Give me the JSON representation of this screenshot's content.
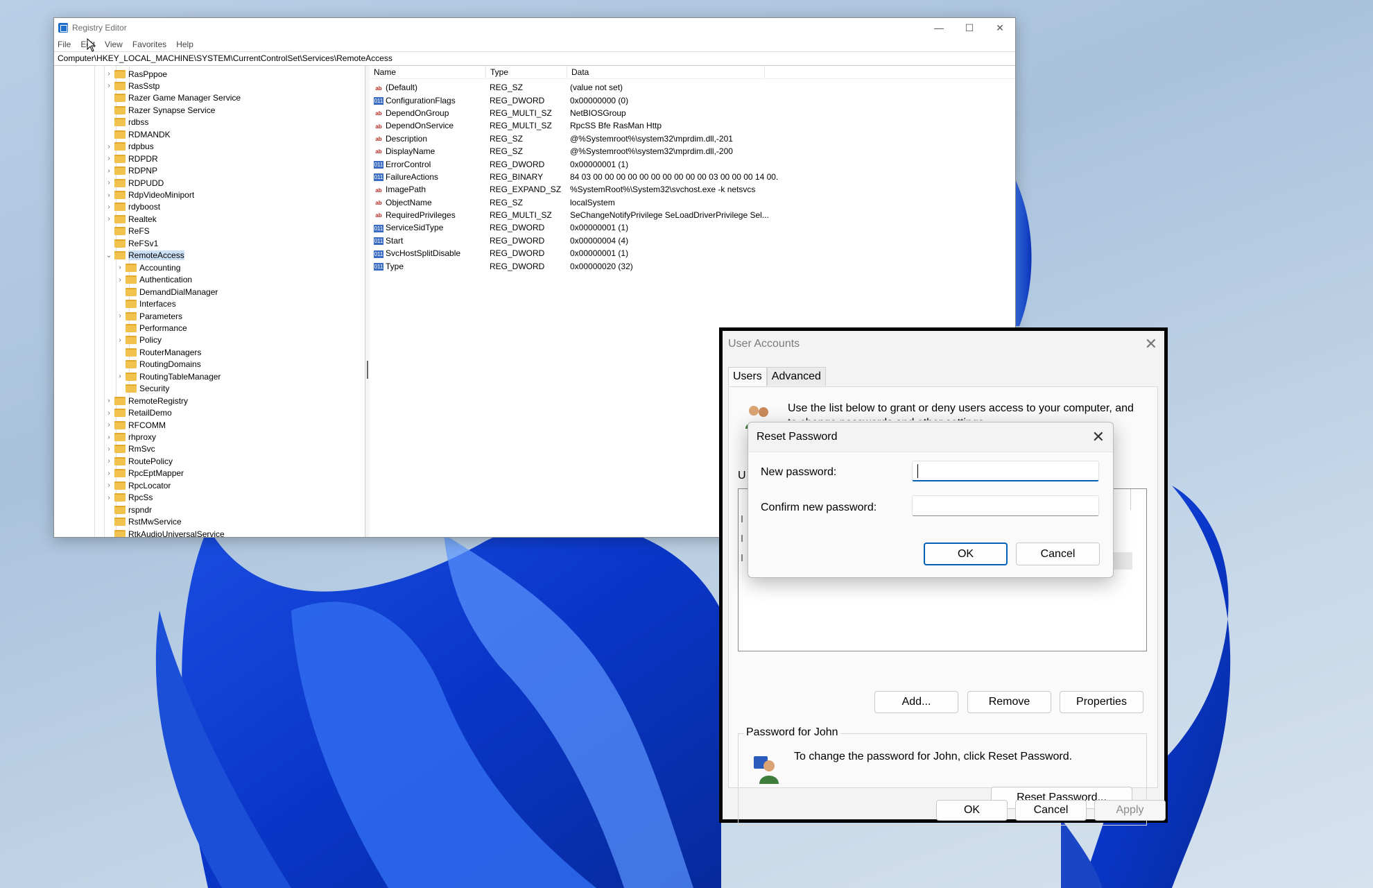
{
  "regedit": {
    "title": "Registry Editor",
    "menu": [
      "File",
      "Edit",
      "View",
      "Favorites",
      "Help"
    ],
    "address": "Computer\\HKEY_LOCAL_MACHINE\\SYSTEM\\CurrentControlSet\\Services\\RemoteAccess",
    "tree": [
      {
        "label": "RasPppoe",
        "level": 0,
        "expander": true
      },
      {
        "label": "RasSstp",
        "level": 0,
        "expander": true
      },
      {
        "label": "Razer Game Manager Service",
        "level": 0,
        "expander": false
      },
      {
        "label": "Razer Synapse Service",
        "level": 0,
        "expander": false
      },
      {
        "label": "rdbss",
        "level": 0,
        "expander": false
      },
      {
        "label": "RDMANDK",
        "level": 0,
        "expander": false
      },
      {
        "label": "rdpbus",
        "level": 0,
        "expander": true
      },
      {
        "label": "RDPDR",
        "level": 0,
        "expander": true
      },
      {
        "label": "RDPNP",
        "level": 0,
        "expander": true
      },
      {
        "label": "RDPUDD",
        "level": 0,
        "expander": true
      },
      {
        "label": "RdpVideoMiniport",
        "level": 0,
        "expander": true
      },
      {
        "label": "rdyboost",
        "level": 0,
        "expander": true
      },
      {
        "label": "Realtek",
        "level": 0,
        "expander": true
      },
      {
        "label": "ReFS",
        "level": 0,
        "expander": false
      },
      {
        "label": "ReFSv1",
        "level": 0,
        "expander": false
      },
      {
        "label": "RemoteAccess",
        "level": 0,
        "expander": true,
        "expanded": true,
        "selected": true
      },
      {
        "label": "Accounting",
        "level": 1,
        "expander": true
      },
      {
        "label": "Authentication",
        "level": 1,
        "expander": true
      },
      {
        "label": "DemandDialManager",
        "level": 1,
        "expander": false
      },
      {
        "label": "Interfaces",
        "level": 1,
        "expander": false
      },
      {
        "label": "Parameters",
        "level": 1,
        "expander": true
      },
      {
        "label": "Performance",
        "level": 1,
        "expander": false
      },
      {
        "label": "Policy",
        "level": 1,
        "expander": true
      },
      {
        "label": "RouterManagers",
        "level": 1,
        "expander": false
      },
      {
        "label": "RoutingDomains",
        "level": 1,
        "expander": false
      },
      {
        "label": "RoutingTableManager",
        "level": 1,
        "expander": true
      },
      {
        "label": "Security",
        "level": 1,
        "expander": false
      },
      {
        "label": "RemoteRegistry",
        "level": 0,
        "expander": true
      },
      {
        "label": "RetailDemo",
        "level": 0,
        "expander": true
      },
      {
        "label": "RFCOMM",
        "level": 0,
        "expander": true
      },
      {
        "label": "rhproxy",
        "level": 0,
        "expander": true
      },
      {
        "label": "RmSvc",
        "level": 0,
        "expander": true
      },
      {
        "label": "RoutePolicy",
        "level": 0,
        "expander": true
      },
      {
        "label": "RpcEptMapper",
        "level": 0,
        "expander": true
      },
      {
        "label": "RpcLocator",
        "level": 0,
        "expander": true
      },
      {
        "label": "RpcSs",
        "level": 0,
        "expander": true
      },
      {
        "label": "rspndr",
        "level": 0,
        "expander": false
      },
      {
        "label": "RstMwService",
        "level": 0,
        "expander": false
      },
      {
        "label": "RtkAudioUniversalService",
        "level": 0,
        "expander": false
      }
    ],
    "columns": [
      "Name",
      "Type",
      "Data"
    ],
    "values": [
      {
        "name": "(Default)",
        "type": "REG_SZ",
        "data": "(value not set)",
        "icon": "string-value-icon"
      },
      {
        "name": "ConfigurationFlags",
        "type": "REG_DWORD",
        "data": "0x00000000 (0)",
        "icon": "binary-value-icon"
      },
      {
        "name": "DependOnGroup",
        "type": "REG_MULTI_SZ",
        "data": "NetBIOSGroup",
        "icon": "string-value-icon"
      },
      {
        "name": "DependOnService",
        "type": "REG_MULTI_SZ",
        "data": "RpcSS Bfe RasMan Http",
        "icon": "string-value-icon"
      },
      {
        "name": "Description",
        "type": "REG_SZ",
        "data": "@%Systemroot%\\system32\\mprdim.dll,-201",
        "icon": "string-value-icon"
      },
      {
        "name": "DisplayName",
        "type": "REG_SZ",
        "data": "@%Systemroot%\\system32\\mprdim.dll,-200",
        "icon": "string-value-icon"
      },
      {
        "name": "ErrorControl",
        "type": "REG_DWORD",
        "data": "0x00000001 (1)",
        "icon": "binary-value-icon"
      },
      {
        "name": "FailureActions",
        "type": "REG_BINARY",
        "data": "84 03 00 00 00 00 00 00 00 00 00 00 03 00 00 00 14 00...",
        "icon": "binary-value-icon"
      },
      {
        "name": "ImagePath",
        "type": "REG_EXPAND_SZ",
        "data": "%SystemRoot%\\System32\\svchost.exe -k netsvcs",
        "icon": "string-value-icon"
      },
      {
        "name": "ObjectName",
        "type": "REG_SZ",
        "data": "localSystem",
        "icon": "string-value-icon"
      },
      {
        "name": "RequiredPrivileges",
        "type": "REG_MULTI_SZ",
        "data": "SeChangeNotifyPrivilege SeLoadDriverPrivilege Sel...",
        "icon": "string-value-icon"
      },
      {
        "name": "ServiceSidType",
        "type": "REG_DWORD",
        "data": "0x00000001 (1)",
        "icon": "binary-value-icon"
      },
      {
        "name": "Start",
        "type": "REG_DWORD",
        "data": "0x00000004 (4)",
        "icon": "binary-value-icon"
      },
      {
        "name": "SvcHostSplitDisable",
        "type": "REG_DWORD",
        "data": "0x00000001 (1)",
        "icon": "binary-value-icon"
      },
      {
        "name": "Type",
        "type": "REG_DWORD",
        "data": "0x00000020 (32)",
        "icon": "binary-value-icon"
      }
    ]
  },
  "user_accounts": {
    "title": "User Accounts",
    "tabs": [
      "Users",
      "Advanced"
    ],
    "intro": "Use the list below to grant or deny users access to your computer, and to change passwords and other settings.",
    "users_label_partial": "U",
    "add_label": "Add...",
    "remove_label": "Remove",
    "properties_label": "Properties",
    "password_group_label": "Password for John",
    "password_group_text": "To change the password for John, click Reset Password.",
    "reset_password_label": "Reset Password...",
    "ok_label": "OK",
    "cancel_label": "Cancel",
    "apply_label": "Apply"
  },
  "reset_password": {
    "title": "Reset Password",
    "new_password_label": "New password:",
    "confirm_password_label": "Confirm new password:",
    "new_password_value": "",
    "confirm_password_value": "",
    "ok_label": "OK",
    "cancel_label": "Cancel"
  }
}
